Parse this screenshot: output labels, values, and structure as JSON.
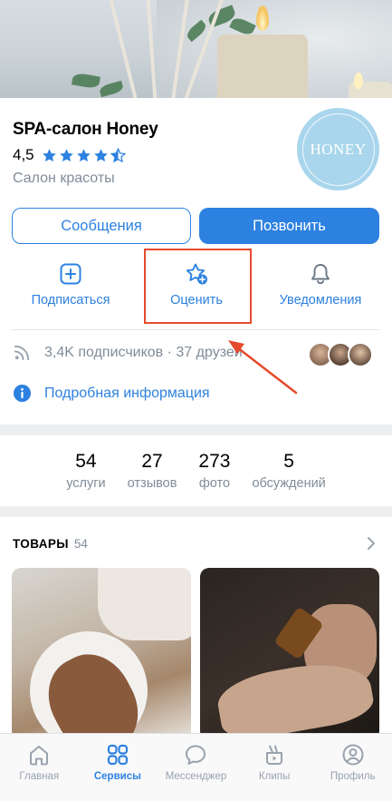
{
  "profile": {
    "name": "SPA-салон Honey",
    "rating": "4,5",
    "rating_value": 4.5,
    "category": "Салон красоты",
    "logo_text": "HONEY"
  },
  "buttons": {
    "messages": "Сообщения",
    "call": "Позвонить"
  },
  "actions": {
    "subscribe": "Подписаться",
    "rate": "Оценить",
    "notifications": "Уведомления"
  },
  "info": {
    "subscribers": "3,4K подписчиков · 37 друзей",
    "more_info": "Подробная информация"
  },
  "counters": [
    {
      "value": "54",
      "label": "услуги"
    },
    {
      "value": "27",
      "label": "отзывов"
    },
    {
      "value": "273",
      "label": "фото"
    },
    {
      "value": "5",
      "label": "обсуждений"
    }
  ],
  "goods": {
    "title": "ТОВАРЫ",
    "count": "54"
  },
  "tabbar": [
    {
      "label": "Главная",
      "icon": "home-icon",
      "active": false
    },
    {
      "label": "Сервисы",
      "icon": "services-icon",
      "active": true
    },
    {
      "label": "Мессенджер",
      "icon": "messenger-icon",
      "active": false
    },
    {
      "label": "Клипы",
      "icon": "clips-icon",
      "active": false
    },
    {
      "label": "Профиль",
      "icon": "profile-icon",
      "active": false
    }
  ],
  "colors": {
    "accent": "#2d81e0",
    "secondary_text": "#818c99",
    "highlight": "#e64a2e",
    "logo_bg": "#a9d6ec"
  }
}
